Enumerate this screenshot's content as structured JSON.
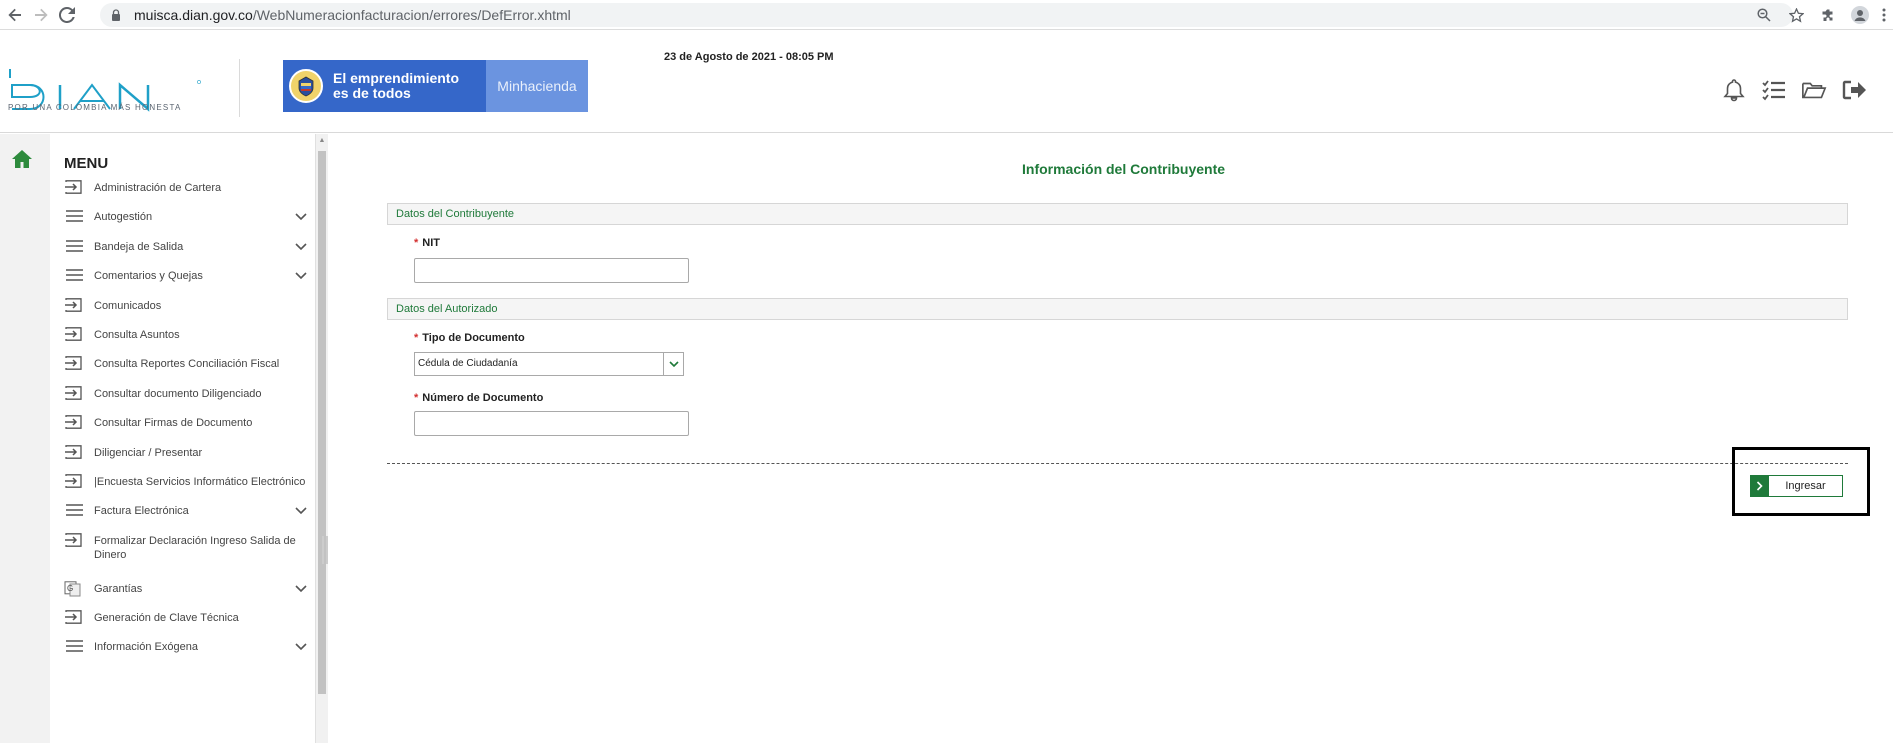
{
  "browser": {
    "url_host": "muisca.dian.gov.co",
    "url_path": "/WebNumeracionfacturacion/errores/DefError.xhtml"
  },
  "header": {
    "logo_text": "DIAN",
    "logo_tagline": "POR UNA COLOMBIA MÁS HONESTA",
    "gov_banner_line1": "El emprendimiento",
    "gov_banner_line2": "es de todos",
    "gov_banner_right": "Minhacienda",
    "date": "23 de Agosto de 2021 - 08:05 PM",
    "icons": [
      "bell-icon",
      "checklist-icon",
      "folder-open-icon",
      "logout-icon"
    ]
  },
  "sidebar": {
    "title": "MENU",
    "items": [
      {
        "label": "Administración de Cartera",
        "icon": "arrow-right-box-icon",
        "expandable": false
      },
      {
        "label": "Autogestión",
        "icon": "hamburger-icon",
        "expandable": true
      },
      {
        "label": "Bandeja de Salida",
        "icon": "hamburger-icon",
        "expandable": true
      },
      {
        "label": "Comentarios y Quejas",
        "icon": "hamburger-icon",
        "expandable": true
      },
      {
        "label": "Comunicados",
        "icon": "arrow-right-box-icon",
        "expandable": false
      },
      {
        "label": "Consulta Asuntos",
        "icon": "arrow-right-box-icon",
        "expandable": false
      },
      {
        "label": "Consulta Reportes Conciliación Fiscal",
        "icon": "arrow-right-box-icon",
        "expandable": false
      },
      {
        "label": "Consultar documento Diligenciado",
        "icon": "arrow-right-box-icon",
        "expandable": false
      },
      {
        "label": "Consultar Firmas de Documento",
        "icon": "arrow-right-box-icon",
        "expandable": false
      },
      {
        "label": "Diligenciar / Presentar",
        "icon": "arrow-right-box-icon",
        "expandable": false
      },
      {
        "label": "|Encuesta Servicios Informático Electrónico",
        "icon": "arrow-right-box-icon",
        "expandable": false
      },
      {
        "label": "Factura Electrónica",
        "icon": "hamburger-icon",
        "expandable": true
      },
      {
        "label": "Formalizar Declaración Ingreso Salida de Dinero",
        "icon": "arrow-right-box-icon",
        "expandable": false
      },
      {
        "label": "Garantías",
        "icon": "g-box-icon",
        "expandable": true
      },
      {
        "label": "Generación de Clave Técnica",
        "icon": "arrow-right-box-icon",
        "expandable": false
      },
      {
        "label": "Información Exógena",
        "icon": "hamburger-icon",
        "expandable": true
      }
    ]
  },
  "main": {
    "title": "Información del Contribuyente",
    "section_contribuyente": "Datos del Contribuyente",
    "nit_label": "NIT",
    "nit_value": "",
    "section_autorizado": "Datos del Autorizado",
    "tipo_doc_label": "Tipo de Documento",
    "tipo_doc_value": "Cédula de Ciudadanía",
    "num_doc_label": "Número de Documento",
    "num_doc_value": "",
    "required_mark": "*",
    "submit_label": "Ingresar"
  },
  "colors": {
    "accent_green": "#1f7a3a",
    "banner_blue": "#3567c9",
    "banner_light_blue": "#6b94e0",
    "dian_teal": "#1fa0c8"
  }
}
